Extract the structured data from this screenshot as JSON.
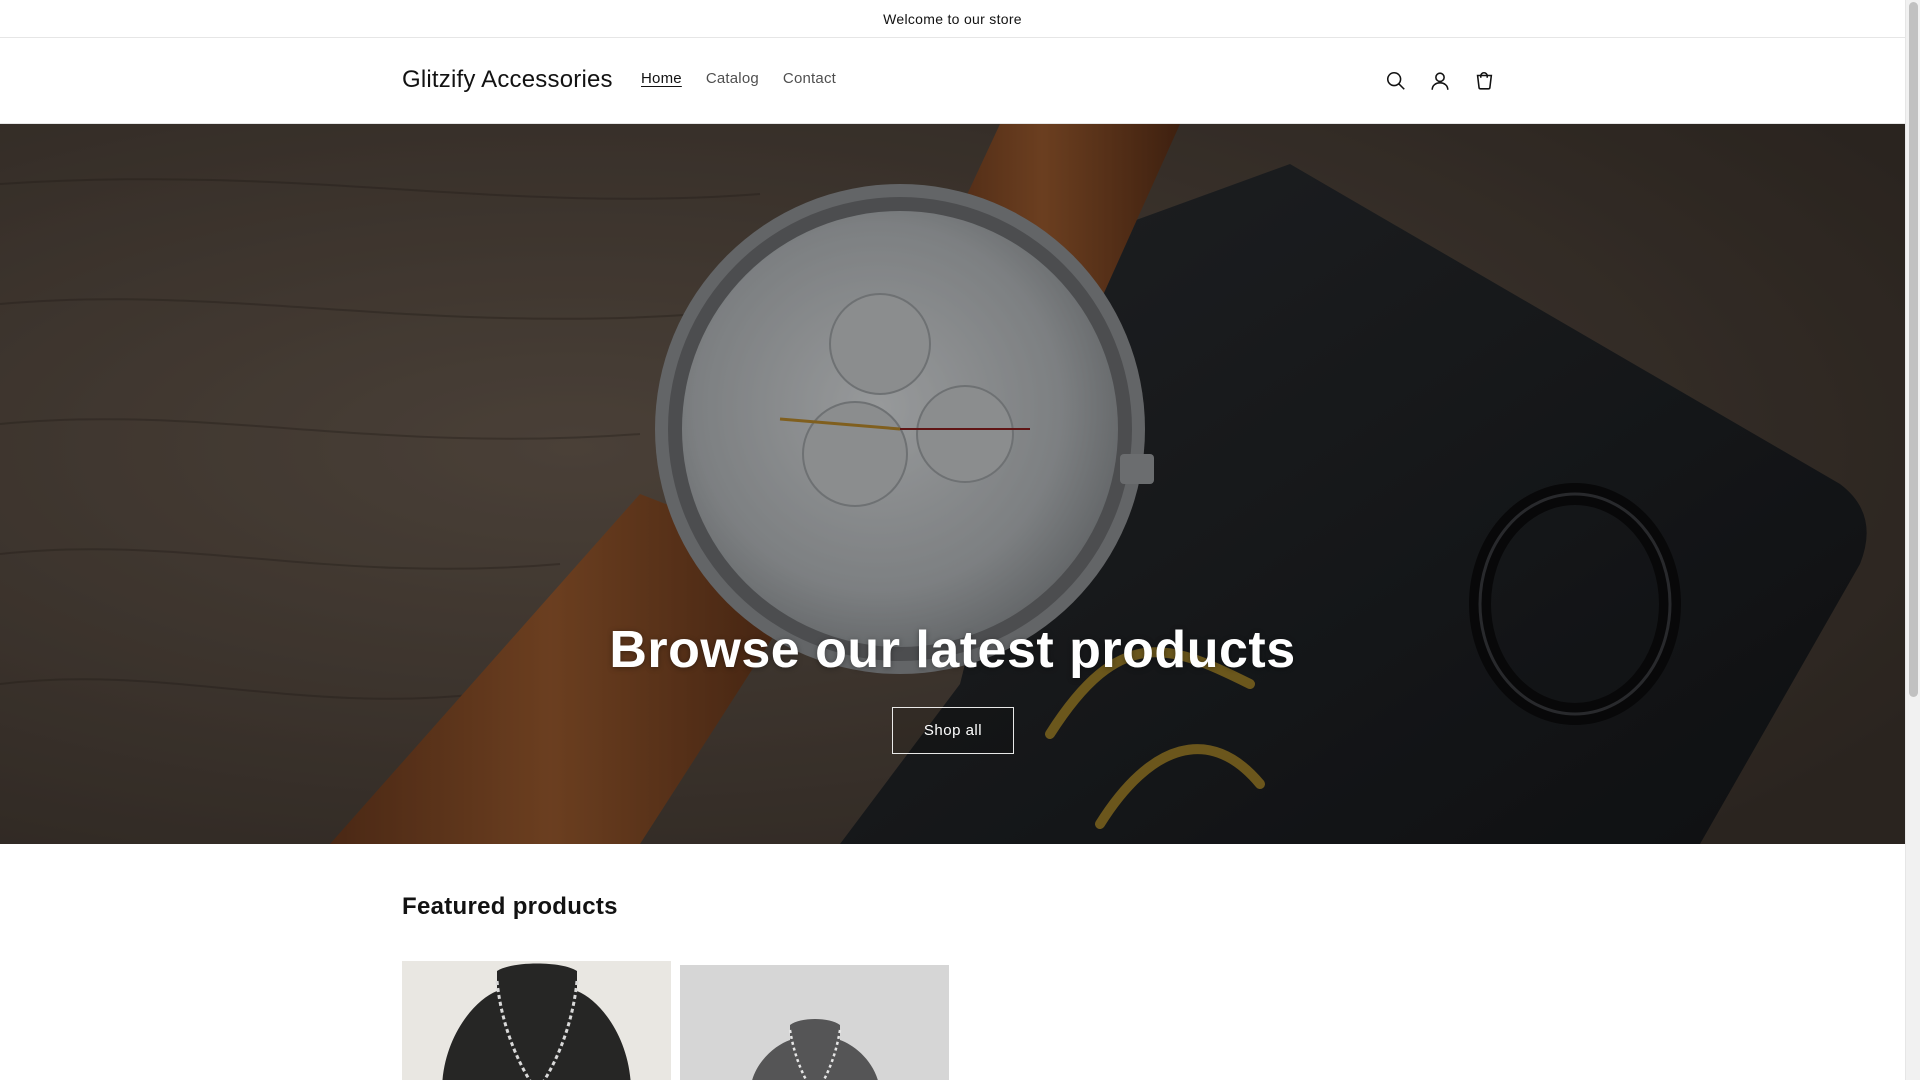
{
  "announcement": {
    "text": "Welcome to our store"
  },
  "header": {
    "logo": "Glitzify Accessories",
    "nav": [
      {
        "label": "Home",
        "active": true
      },
      {
        "label": "Catalog",
        "active": false
      },
      {
        "label": "Contact",
        "active": false
      }
    ],
    "icons": [
      "search-icon",
      "account-icon",
      "cart-icon"
    ]
  },
  "hero": {
    "title": "Browse our latest products",
    "button_label": "Shop all"
  },
  "featured": {
    "title": "Featured products",
    "products": [
      {
        "image": "silver-chain-necklace-on-bust"
      },
      {
        "image": "silver-necklace-on-bust"
      }
    ]
  },
  "colors": {
    "text": "#121212",
    "border": "#e6e6e6",
    "hero_overlay_text": "#ffffff"
  }
}
